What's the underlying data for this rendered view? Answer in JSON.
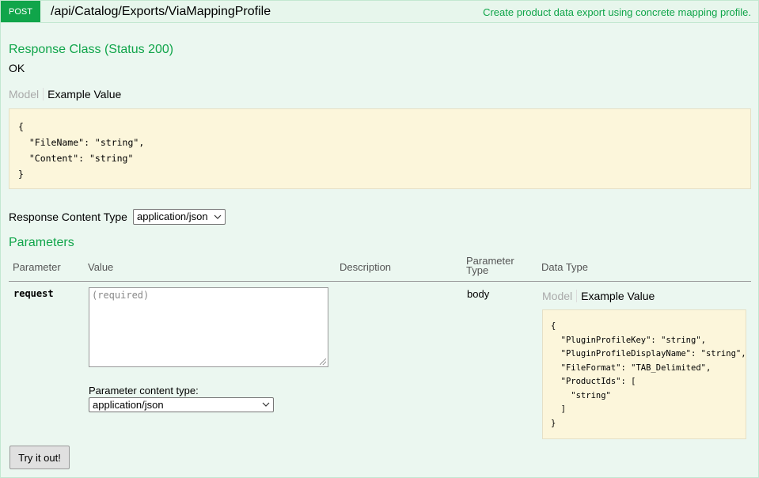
{
  "operation": {
    "method": "POST",
    "path": "/api/Catalog/Exports/ViaMappingProfile",
    "summary": "Create product data export using concrete mapping profile."
  },
  "response": {
    "title": "Response Class (Status 200)",
    "message": "OK",
    "tabs": {
      "model": "Model",
      "example": "Example Value"
    },
    "example_code": "{\n  \"FileName\": \"string\",\n  \"Content\": \"string\"\n}"
  },
  "response_content_type": {
    "label": "Response Content Type",
    "selected": "application/json"
  },
  "parameters": {
    "title": "Parameters",
    "headers": {
      "parameter": "Parameter",
      "value": "Value",
      "description": "Description",
      "parameter_type": "Parameter\nType",
      "data_type": "Data Type"
    },
    "rows": [
      {
        "name": "request",
        "value_placeholder": "(required)",
        "content_type_label": "Parameter content type:",
        "content_type_selected": "application/json",
        "type": "body",
        "tabs": {
          "model": "Model",
          "example": "Example Value"
        },
        "example_code": "{\n  \"PluginProfileKey\": \"string\",\n  \"PluginProfileDisplayName\": \"string\",\n  \"FileFormat\": \"TAB_Delimited\",\n  \"ProductIds\": [\n    \"string\"\n  ]\n}"
      }
    ]
  },
  "submit": {
    "label": "Try it out!"
  },
  "colors": {
    "accent_green": "#10a54a",
    "panel_bg": "#ebf7f0",
    "code_bg": "#fcf6db"
  }
}
